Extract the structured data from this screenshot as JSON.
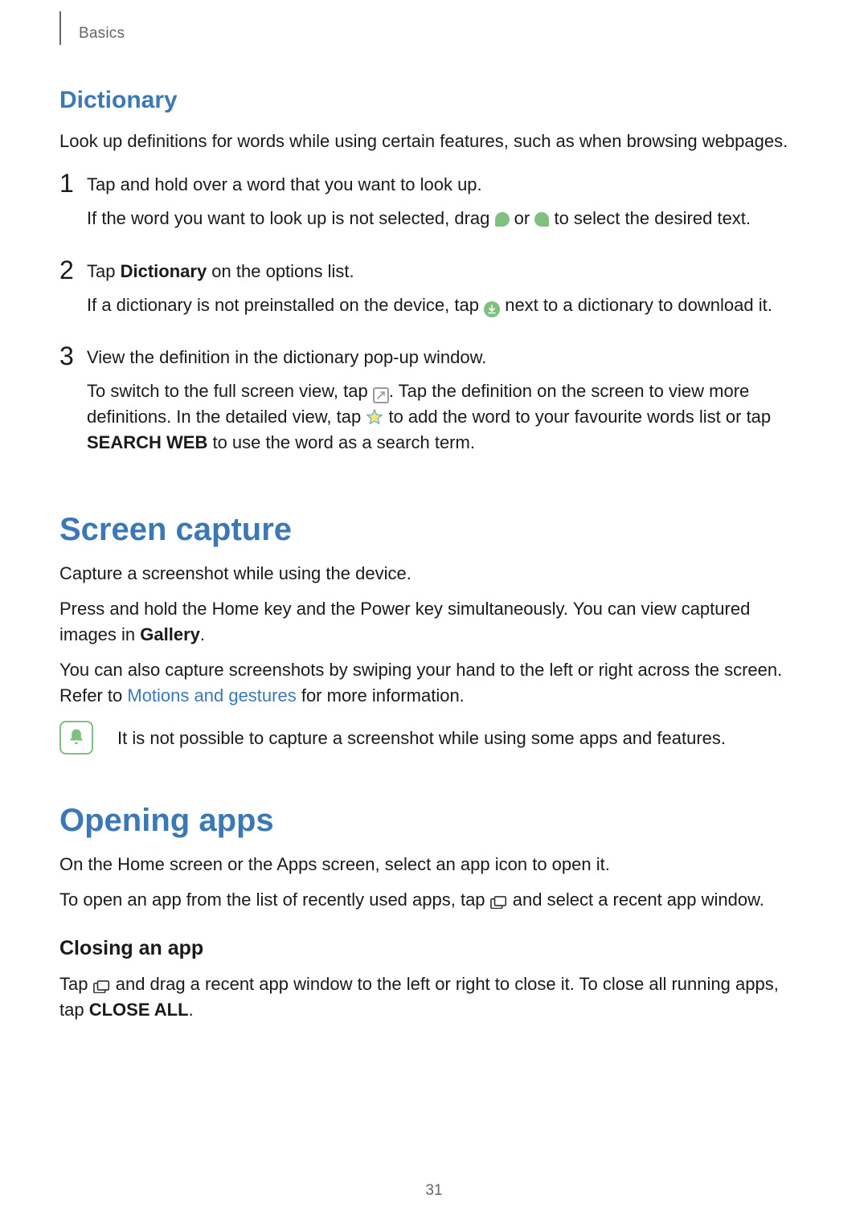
{
  "header": {
    "section": "Basics"
  },
  "dictionary": {
    "title": "Dictionary",
    "intro": "Look up definitions for words while using certain features, such as when browsing webpages.",
    "steps": {
      "s1": {
        "num": "1",
        "p1": "Tap and hold over a word that you want to look up.",
        "p2a": "If the word you want to look up is not selected, drag ",
        "p2b": " or ",
        "p2c": " to select the desired text."
      },
      "s2": {
        "num": "2",
        "p1a": "Tap ",
        "p1bold": "Dictionary",
        "p1b": " on the options list.",
        "p2a": "If a dictionary is not preinstalled on the device, tap ",
        "p2b": " next to a dictionary to download it."
      },
      "s3": {
        "num": "3",
        "p1": "View the definition in the dictionary pop-up window.",
        "p2a": "To switch to the full screen view, tap ",
        "p2b": ". Tap the definition on the screen to view more definitions. In the detailed view, tap ",
        "p2c": " to add the word to your favourite words list or tap ",
        "p2bold": "SEARCH WEB",
        "p2d": " to use the word as a search term."
      }
    }
  },
  "screen_capture": {
    "title": "Screen capture",
    "p1": "Capture a screenshot while using the device.",
    "p2a": "Press and hold the Home key and the Power key simultaneously. You can view captured images in ",
    "p2bold": "Gallery",
    "p2b": ".",
    "p3a": "You can also capture screenshots by swiping your hand to the left or right across the screen. Refer to ",
    "p3link": "Motions and gestures",
    "p3b": " for more information.",
    "note": "It is not possible to capture a screenshot while using some apps and features."
  },
  "opening_apps": {
    "title": "Opening apps",
    "p1": "On the Home screen or the Apps screen, select an app icon to open it.",
    "p2a": "To open an app from the list of recently used apps, tap ",
    "p2b": " and select a recent app window.",
    "closing": {
      "title": "Closing an app",
      "p1a": "Tap ",
      "p1b": " and drag a recent app window to the left or right to close it. To close all running apps, tap ",
      "p1bold": "CLOSE ALL",
      "p1c": "."
    }
  },
  "page_number": "31"
}
